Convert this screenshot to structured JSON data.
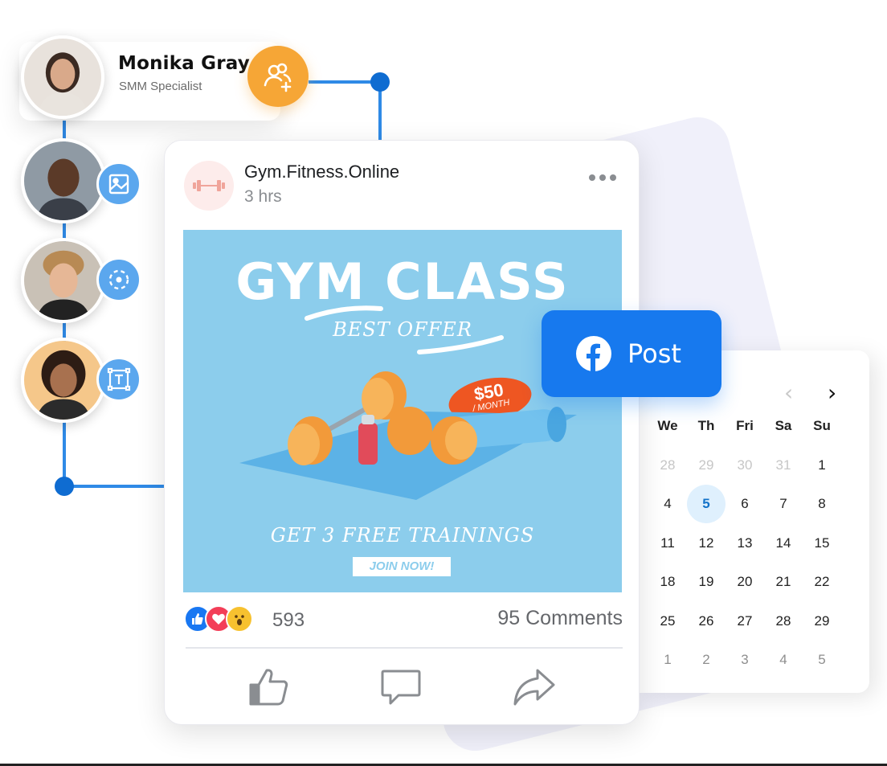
{
  "profile": {
    "name": "Monika Gray",
    "role": "SMM Specialist"
  },
  "team_members": [
    {
      "badge_icon": "image-icon"
    },
    {
      "badge_icon": "progress-circle-icon"
    },
    {
      "badge_icon": "text-box-icon"
    }
  ],
  "post": {
    "page_name": "Gym.Fitness.Online",
    "time": "3 hrs",
    "image": {
      "title": "GYM CLASS",
      "offer": "BEST OFFER",
      "price": "$50",
      "price_unit": "/ MONTH",
      "promo": "GET 3 FREE TRAININGS",
      "cta": "JOIN NOW!"
    },
    "reaction_count": "593",
    "comments": "95 Comments",
    "reactions": [
      "like-icon",
      "love-icon",
      "wow-icon"
    ],
    "actions": [
      "like-action-icon",
      "comment-action-icon",
      "share-action-icon"
    ]
  },
  "post_button": {
    "label": "Post",
    "icon": "facebook-icon"
  },
  "calendar": {
    "weekdays": [
      "We",
      "Th",
      "Fri",
      "Sa",
      "Su"
    ],
    "weeks": [
      [
        {
          "d": "28",
          "s": "muted"
        },
        {
          "d": "29",
          "s": "muted"
        },
        {
          "d": "30",
          "s": "muted"
        },
        {
          "d": "31",
          "s": "muted"
        },
        {
          "d": "1",
          "s": ""
        }
      ],
      [
        {
          "d": "4",
          "s": ""
        },
        {
          "d": "5",
          "s": "selected"
        },
        {
          "d": "6",
          "s": ""
        },
        {
          "d": "7",
          "s": ""
        },
        {
          "d": "8",
          "s": ""
        }
      ],
      [
        {
          "d": "11",
          "s": ""
        },
        {
          "d": "12",
          "s": ""
        },
        {
          "d": "13",
          "s": ""
        },
        {
          "d": "14",
          "s": ""
        },
        {
          "d": "15",
          "s": ""
        }
      ],
      [
        {
          "d": "18",
          "s": ""
        },
        {
          "d": "19",
          "s": ""
        },
        {
          "d": "20",
          "s": ""
        },
        {
          "d": "21",
          "s": ""
        },
        {
          "d": "22",
          "s": ""
        }
      ],
      [
        {
          "d": "25",
          "s": ""
        },
        {
          "d": "26",
          "s": ""
        },
        {
          "d": "27",
          "s": ""
        },
        {
          "d": "28",
          "s": ""
        },
        {
          "d": "29",
          "s": ""
        }
      ],
      [
        {
          "d": "1",
          "s": "next-month"
        },
        {
          "d": "2",
          "s": "next-month"
        },
        {
          "d": "3",
          "s": "next-month"
        },
        {
          "d": "4",
          "s": "next-month"
        },
        {
          "d": "5",
          "s": "next-month"
        }
      ]
    ],
    "selected_color": "#1473c9"
  },
  "colors": {
    "accent_orange": "#f6a636",
    "facebook_blue": "#1779ee",
    "badge_blue": "#5ba7ee",
    "connector_blue": "#2f8ae6"
  }
}
